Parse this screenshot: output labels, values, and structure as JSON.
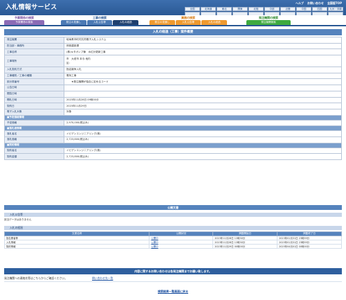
{
  "app": {
    "title": "入札情報サービス"
  },
  "header": {
    "links": [
      "ヘルプ",
      "お問い合わせ",
      "全国版TOP"
    ],
    "regions": [
      "全国",
      "北海道",
      "東北",
      "関東",
      "北陸",
      "中部",
      "近畿",
      "中国",
      "四国",
      "九州・沖縄",
      "",
      "",
      "",
      "",
      "",
      "",
      "",
      "",
      "",
      ""
    ]
  },
  "nav": {
    "groups": [
      {
        "title": "予算関係の検索",
        "tabs": [
          "予算関係の検索"
        ]
      },
      {
        "title": "工事の検索",
        "tabs": [
          "発注の見通し",
          "入札公告等",
          "入札の経過"
        ],
        "active": 2
      },
      {
        "title": "業務の検索",
        "tabs": [
          "発注の見通し",
          "入札公告等",
          "入札の経過"
        ]
      },
      {
        "title": "発注機関の検索",
        "tabs": [
          "発注機関検索"
        ]
      }
    ]
  },
  "page": {
    "heading": "入札の経過（工事）案件概要"
  },
  "info": {
    "rows": [
      {
        "label": "発注機関",
        "value": "岐阜県市町村共同電子入札システム"
      },
      {
        "label": "担当部・事務所",
        "value": "林政建設課"
      },
      {
        "label": "工事名称",
        "value": "(株)キタガンプ棟　水位計更新工事"
      },
      {
        "label": "工事場所",
        "value": "市　大垣市 本今 地内"
      },
      {
        "label": "工事場所2",
        "value": "区："
      },
      {
        "label": "入札契約方式",
        "value": "指名競争入札"
      },
      {
        "label": "工事種別／工事の種類",
        "value": "電気工事"
      },
      {
        "label": "設計書番号",
        "value": "　　★発注機関が独自に定めるコード"
      },
      {
        "label": "公告日時",
        "value": ""
      },
      {
        "label": "閲覧日時",
        "value": ""
      },
      {
        "label": "開札日時",
        "value": "2023年11月28日 09時00分"
      },
      {
        "label": "契約日",
        "value": "2023年11月29日"
      },
      {
        "label": "電子入札対象",
        "value": "対象"
      }
    ],
    "estimate_group": "■予定価格情報",
    "estimate_label": "予定価格",
    "estimate_value": "2,970,000(税込み)",
    "winner_group": "■落札者情報",
    "winner_label": "落札者名",
    "winner_value": "イビデンエンジニアリング(株)",
    "winning_price_label": "落札価格",
    "winning_price_value": "2,723,800(税込み)",
    "contract_group": "■契約情報",
    "contract_label": "契約者名",
    "contract_value": "イビデンエンジニアリング(株)",
    "contract_amount_label": "契約金額",
    "contract_amount_value": "2,723,800(税込み)"
  },
  "notices": {
    "heading": "公開文書",
    "bid_notice_heading": "入札公告等",
    "no_data": "該当データはありません",
    "bid_progress_heading": "入札の経過",
    "columns": [
      "文書名称",
      "公開状況",
      "掲載開始日",
      "掲載終了日"
    ],
    "rows": [
      {
        "name": "指名業者等",
        "status": "公開中",
        "start": "2023年11月28日 13時30分",
        "end": "2023年01月31日 23時59分"
      },
      {
        "name": "入札情報",
        "status": "公開中",
        "start": "2023年11月28日 13時30分",
        "end": "2025年01月31日 23時59分"
      },
      {
        "name": "契約情報",
        "status": "公開中",
        "start": "2023年11月29日 00時00分",
        "end": "2025年04月01日 00時00分"
      }
    ]
  },
  "contact": {
    "heading": "内容に関するお問い合わせは各発注機関までお願い致します。",
    "text": "発注機関への連絡先等はこちらからご確認ください。",
    "link": "問い合わせ先一覧"
  },
  "back": {
    "label": "検索結果一覧画面に戻る"
  }
}
